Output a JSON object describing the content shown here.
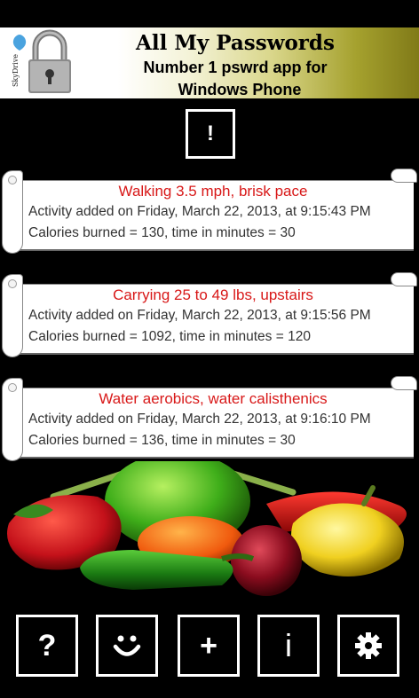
{
  "ad": {
    "logo_text": "SkyDrive",
    "title": "All My Passwords",
    "line1": "Number 1 pswrd app for",
    "line2": "Windows Phone"
  },
  "alert_button": {
    "label": "!"
  },
  "activities": [
    {
      "title": "Walking 3.5 mph, brisk pace",
      "added": "Activity added on Friday, March 22, 2013, at 9:15:43 PM",
      "stats": "Calories burned = 130, time in minutes = 30"
    },
    {
      "title": "Carrying 25 to 49 lbs, upstairs",
      "added": "Activity added on Friday, March 22, 2013, at 9:15:56 PM",
      "stats": "Calories burned = 1092, time in minutes = 120"
    },
    {
      "title": "Water aerobics, water calisthenics",
      "added": "Activity added on Friday, March 22, 2013, at 9:16:10 PM",
      "stats": "Calories burned = 136, time in minutes = 30"
    }
  ],
  "toolbar": {
    "help_label": "?",
    "add_label": "+",
    "info_label": "i",
    "smile_icon": "smiley-icon",
    "settings_icon": "gear-icon"
  },
  "colors": {
    "activity_title": "#d81818",
    "background": "#000000"
  }
}
